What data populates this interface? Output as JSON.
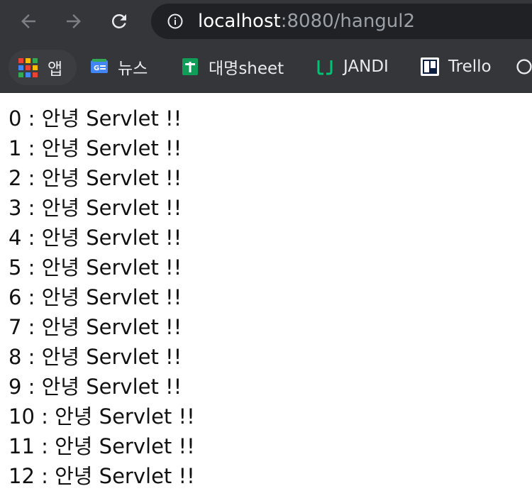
{
  "browser": {
    "url_host": "localhost",
    "url_rest": ":8080/hangul2",
    "nav": {
      "back_icon": "arrow-left-icon",
      "forward_icon": "arrow-right-icon",
      "reload_icon": "reload-icon",
      "info_icon": "info-icon"
    }
  },
  "bookmarks": [
    {
      "label": "앱",
      "icon": "apps-grid-icon"
    },
    {
      "label": "뉴스",
      "icon": "google-news-icon"
    },
    {
      "label": "대명sheet",
      "icon": "sheets-icon"
    },
    {
      "label": "JANDI",
      "icon": "jandi-icon"
    },
    {
      "label": "Trello",
      "icon": "trello-icon"
    }
  ],
  "lines": [
    "0 : 안녕 Servlet !!",
    "1 : 안녕 Servlet !!",
    "2 : 안녕 Servlet !!",
    "3 : 안녕 Servlet !!",
    "4 : 안녕 Servlet !!",
    "5 : 안녕 Servlet !!",
    "6 : 안녕 Servlet !!",
    "7 : 안녕 Servlet !!",
    "8 : 안녕 Servlet !!",
    "9 : 안녕 Servlet !!",
    "10 : 안녕 Servlet !!",
    "11 : 안녕 Servlet !!",
    "12 : 안녕 Servlet !!"
  ]
}
